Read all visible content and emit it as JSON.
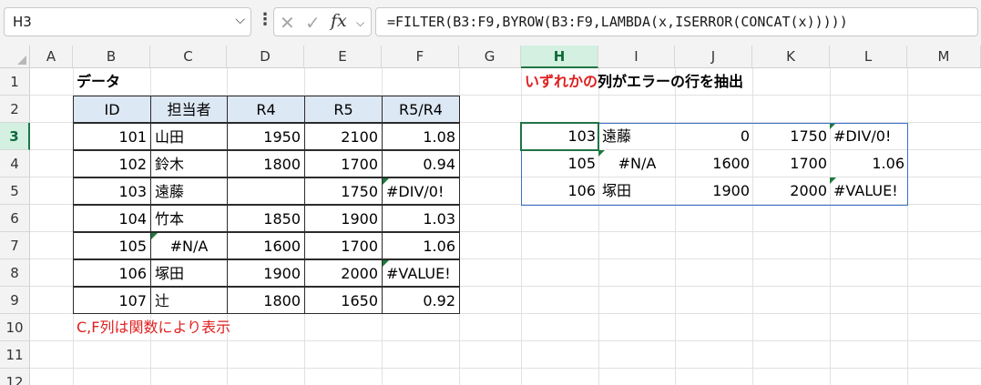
{
  "formula_bar": {
    "name_box": "H3",
    "fx_label": "fx",
    "formula": "=FILTER(B3:F9,BYROW(B3:F9,LAMBDA(x,ISERROR(CONCAT(x)))))"
  },
  "columns": [
    "A",
    "B",
    "C",
    "D",
    "E",
    "F",
    "G",
    "H",
    "I",
    "J",
    "K",
    "L",
    "M"
  ],
  "rows": [
    "1",
    "2",
    "3",
    "4",
    "5",
    "6",
    "7",
    "8",
    "9",
    "10",
    "11",
    "12"
  ],
  "left_title": "データ",
  "table": {
    "headers": [
      "ID",
      "担当者",
      "R4",
      "R5",
      "R5/R4"
    ],
    "rows": [
      [
        "101",
        "山田",
        "1950",
        "2100",
        "1.08"
      ],
      [
        "102",
        "鈴木",
        "1800",
        "1700",
        "0.94"
      ],
      [
        "103",
        "遠藤",
        "",
        "1750",
        "#DIV/0!"
      ],
      [
        "104",
        "竹本",
        "1850",
        "1900",
        "1.03"
      ],
      [
        "105",
        "#N/A",
        "1600",
        "1700",
        "1.06"
      ],
      [
        "106",
        "塚田",
        "1900",
        "2000",
        "#VALUE!"
      ],
      [
        "107",
        "辻",
        "1800",
        "1650",
        "0.92"
      ]
    ]
  },
  "note": "C,F列は関数により表示",
  "right_title": {
    "highlight": "いずれかの",
    "rest": "列がエラーの行を抽出"
  },
  "result": {
    "rows": [
      [
        "103",
        "遠藤",
        "0",
        "1750",
        "#DIV/0!"
      ],
      [
        "105",
        "#N/A",
        "1600",
        "1700",
        "1.06"
      ],
      [
        "106",
        "塚田",
        "1900",
        "2000",
        "#VALUE!"
      ]
    ]
  },
  "colors": {
    "accent_green": "#217346",
    "header_fill": "#dde8f5",
    "note_red": "#e02020",
    "spill_border": "#3a6fc9",
    "error_triangle": "#1e7a3a"
  }
}
